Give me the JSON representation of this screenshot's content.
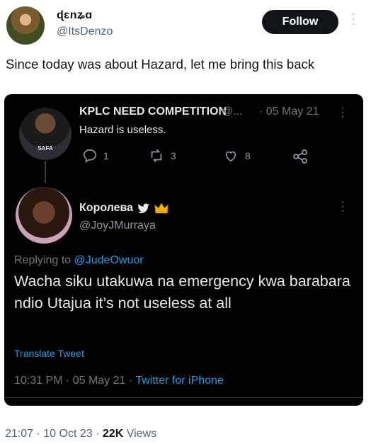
{
  "author": {
    "name": "ɖɛnʑɑ",
    "handle": "@ItsDenzo",
    "follow_label": "Follow"
  },
  "tweet": {
    "text": "Since today was about Hazard, let me bring this back",
    "time": "21:07",
    "date": "10 Oct 23",
    "views_count": "22K",
    "views_label": "Views"
  },
  "embedded": {
    "first": {
      "name": "KPLC NEED COMPETITION",
      "handle": "@...",
      "date": "· 05 May 21",
      "text": "Hazard is useless.",
      "avatar_badge": "SAFA",
      "replies": "1",
      "retweets": "3",
      "likes": "8"
    },
    "second": {
      "name": "Королева",
      "handle": "@JoyJMurraya",
      "replying_prefix": "Replying to",
      "replying_to": "@JudeOwuor",
      "text": "Wacha siku utakuwa na emergency kwa barabara ndio Utajua it’s not useless at all",
      "translate": "Translate Tweet",
      "time": "10:31 PM · 05 May 21 ·",
      "source": "Twitter for iPhone"
    }
  },
  "colors": {
    "accent": "#1d9bf0",
    "card_bg": "#000000"
  }
}
